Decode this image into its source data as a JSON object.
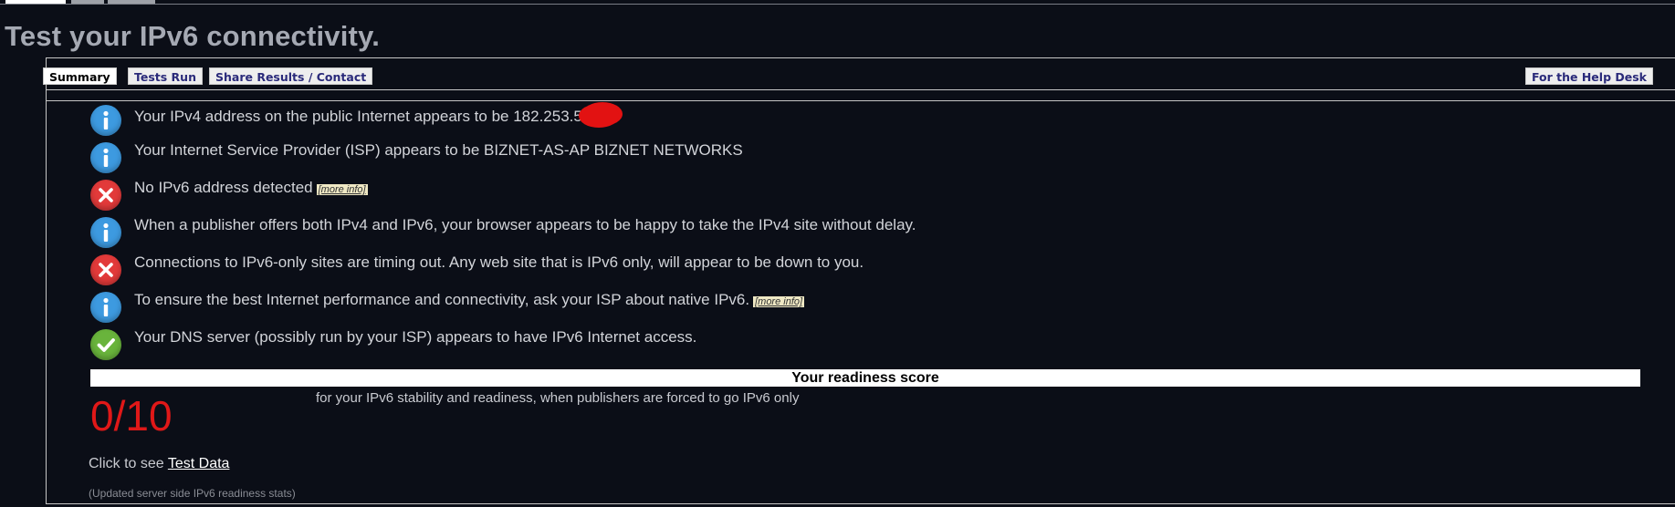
{
  "page": {
    "title": "Test your IPv6 connectivity."
  },
  "tabs": [
    {
      "label": "Summary",
      "active": true
    },
    {
      "label": "Tests Run",
      "active": false
    },
    {
      "label": "Share Results / Contact",
      "active": false
    },
    {
      "label": "For the Help Desk",
      "active": false
    }
  ],
  "results": [
    {
      "icon": "info-icon",
      "text": "Your IPv4 address on the public Internet appears to be 182.253.5"
    },
    {
      "icon": "info-icon",
      "text": "Your Internet Service Provider (ISP) appears to be BIZNET-AS-AP BIZNET NETWORKS"
    },
    {
      "icon": "error-icon",
      "text": "No IPv6 address detected",
      "link": "[more info]"
    },
    {
      "icon": "info-icon",
      "text": "When a publisher offers both IPv4 and IPv6, your browser appears to be happy to take the IPv4 site without delay."
    },
    {
      "icon": "error-icon",
      "text": "Connections to IPv6-only sites are timing out. Any web site that is IPv6 only, will appear to be down to you."
    },
    {
      "icon": "info-icon",
      "text": "To ensure the best Internet performance and connectivity, ask your ISP about native IPv6.",
      "link": "[more info]"
    },
    {
      "icon": "check-icon",
      "text": "Your DNS server (possibly run by your ISP) appears to have IPv6 Internet access."
    }
  ],
  "readiness": {
    "heading": "Your readiness score",
    "score": "0/10",
    "description": "for your IPv6 stability and readiness, when publishers are forced to go IPv6 only"
  },
  "footer": {
    "click_prefix": "Click to see",
    "test_data_link": "Test Data",
    "updated_note": "(Updated server side IPv6 readiness stats)"
  },
  "colors": {
    "background": "#0b0e17",
    "info": "#3d9ae0",
    "error": "#e23a3a",
    "ok": "#69b43c",
    "score": "#e01818"
  }
}
